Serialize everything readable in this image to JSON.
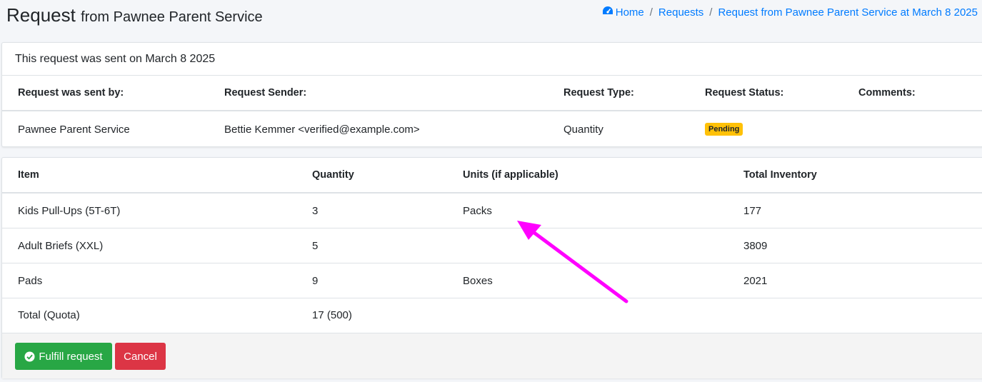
{
  "header": {
    "title": "Request",
    "subtitle": "from Pawnee Parent Service"
  },
  "breadcrumb": {
    "home": "Home",
    "requests": "Requests",
    "current": "Request from Pawnee Parent Service at March 8 2025"
  },
  "summary": {
    "sent_text": "This request was sent on March 8 2025",
    "columns": [
      "Request was sent by:",
      "Request Sender:",
      "Request Type:",
      "Request Status:",
      "Comments:"
    ],
    "values": {
      "sent_by": "Pawnee Parent Service",
      "sender": "Bettie Kemmer <verified@example.com>",
      "type": "Quantity",
      "status": "Pending",
      "comments": ""
    }
  },
  "items_table": {
    "columns": [
      "Item",
      "Quantity",
      "Units (if applicable)",
      "Total Inventory"
    ],
    "rows": [
      {
        "item": "Kids Pull-Ups (5T-6T)",
        "quantity": "3",
        "units": "Packs",
        "inventory": "177"
      },
      {
        "item": "Adult Briefs (XXL)",
        "quantity": "5",
        "units": "",
        "inventory": "3809"
      },
      {
        "item": "Pads",
        "quantity": "9",
        "units": "Boxes",
        "inventory": "2021"
      }
    ],
    "total": {
      "label": "Total (Quota)",
      "quantity": "17 (500)"
    }
  },
  "actions": {
    "fulfill_label": "Fulfill request",
    "cancel_label": "Cancel"
  },
  "colors": {
    "link": "#007bff",
    "pending_badge": "#ffc107",
    "success": "#28a745",
    "danger": "#dc3545",
    "annotation_arrow": "#ff00ff"
  },
  "icons": {
    "home": "tachometer-icon",
    "fulfill": "check-circle-icon",
    "annotation": "arrow-annotation"
  }
}
